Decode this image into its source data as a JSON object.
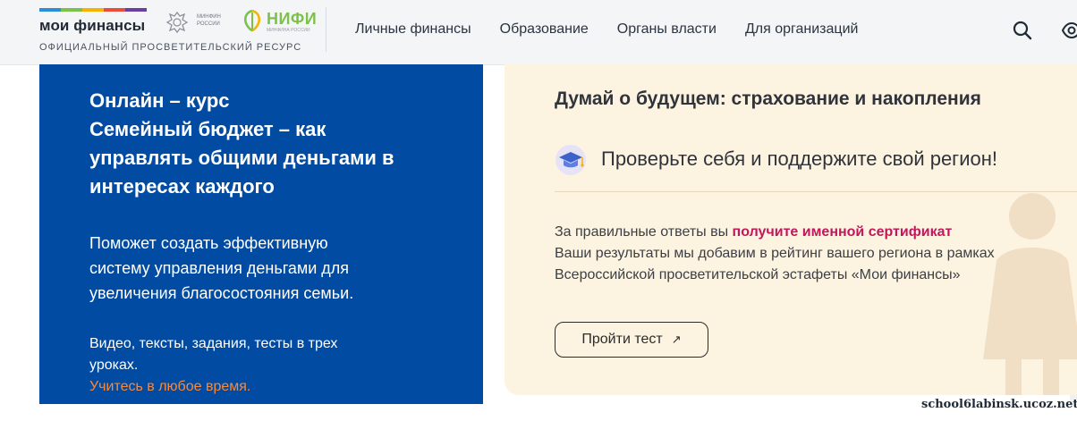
{
  "header": {
    "logo_title": "мои финансы",
    "logo_subtitle": "ОФИЦИАЛЬНЫЙ ПРОСВЕТИТЕЛЬСКИЙ РЕСУРС",
    "logo_stripe_colors": [
      "#2b8fd6",
      "#7cc24a",
      "#f5b400",
      "#e94e3c",
      "#6b3fa0"
    ],
    "minfin_line1": "МИНФИН",
    "minfin_line2": "РОССИИ",
    "nifi_title": "НИФИ",
    "nifi_subtitle": "МИНФИНА РОССИИ",
    "nav": [
      "Личные финансы",
      "Образование",
      "Органы власти",
      "Для организаций"
    ],
    "icons": [
      "search-icon",
      "eye-icon"
    ]
  },
  "course_card": {
    "heading_lines": [
      "Онлайн – курс",
      "Семейный бюджет – как",
      "управлять общими деньгами в",
      "интересах каждого"
    ],
    "description_lines": [
      "Поможет создать эффективную",
      "систему управления деньгами для",
      "увеличения благосостояния семьи."
    ],
    "meta_lines": [
      "Видео, тексты, задания, тесты в трех",
      "уроках."
    ],
    "meta_highlight": "Учитесь в любое время.",
    "background_color": "#014ba2",
    "highlight_color": "#f78a3d"
  },
  "test_card": {
    "title": "Думай о будущем: страхование и накопления",
    "subtitle": "Проверьте себя и поддержите свой регион!",
    "text_prefix": "За правильные ответы вы ",
    "text_highlight": "получите именной сертификат",
    "text_lines": [
      "Ваши результаты мы добавим в рейтинг вашего региона в рамках",
      "Всероссийской просветительской эстафеты «Мои финансы»"
    ],
    "button_label": "Пройти тест",
    "button_icon": "arrow-up-right-icon",
    "background_color": "#fdf3e1",
    "highlight_color": "#c2185b"
  },
  "watermark": "school6labinsk.ucoz.net"
}
